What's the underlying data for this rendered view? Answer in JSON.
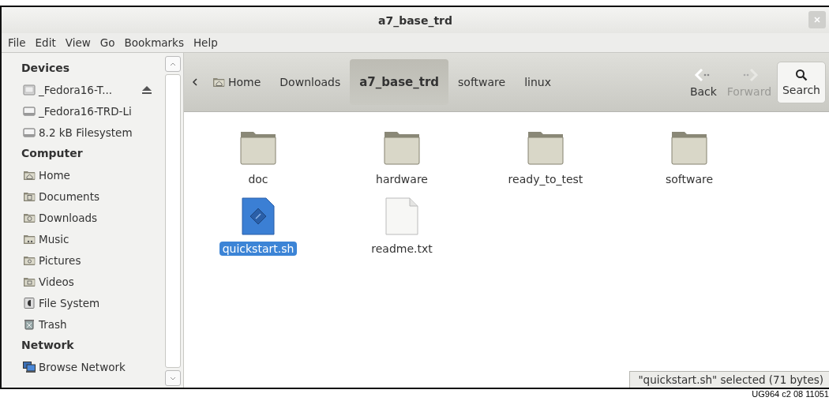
{
  "window": {
    "title": "a7_base_trd"
  },
  "menu": [
    "File",
    "Edit",
    "View",
    "Go",
    "Bookmarks",
    "Help"
  ],
  "sidebar": {
    "sections": [
      {
        "title": "Devices",
        "items": [
          {
            "label": "_Fedora16-T...",
            "kind": "drive",
            "ejectable": true
          },
          {
            "label": "_Fedora16-TRD-Li",
            "kind": "disk",
            "ejectable": false
          },
          {
            "label": "8.2 kB Filesystem",
            "kind": "disk",
            "ejectable": false
          }
        ]
      },
      {
        "title": "Computer",
        "items": [
          {
            "label": "Home",
            "kind": "home",
            "ejectable": false
          },
          {
            "label": "Documents",
            "kind": "documents",
            "ejectable": false
          },
          {
            "label": "Downloads",
            "kind": "downloads",
            "ejectable": false
          },
          {
            "label": "Music",
            "kind": "music",
            "ejectable": false
          },
          {
            "label": "Pictures",
            "kind": "pictures",
            "ejectable": false
          },
          {
            "label": "Videos",
            "kind": "videos",
            "ejectable": false
          },
          {
            "label": "File System",
            "kind": "filesystem",
            "ejectable": false
          },
          {
            "label": "Trash",
            "kind": "trash",
            "ejectable": false
          }
        ]
      },
      {
        "title": "Network",
        "items": [
          {
            "label": "Browse Network",
            "kind": "network",
            "ejectable": false
          }
        ]
      }
    ]
  },
  "path_bar": [
    {
      "label": "Home",
      "kind": "home",
      "selected": false
    },
    {
      "label": "Downloads",
      "kind": "folder",
      "selected": false
    },
    {
      "label": "a7_base_trd",
      "kind": "folder",
      "selected": true
    },
    {
      "label": "software",
      "kind": "folder",
      "selected": false
    },
    {
      "label": "linux",
      "kind": "folder",
      "selected": false
    }
  ],
  "nav": [
    {
      "label": "Back",
      "kind": "back",
      "disabled": false
    },
    {
      "label": "Forward",
      "kind": "forward",
      "disabled": true
    }
  ],
  "search": {
    "label": "Search"
  },
  "files": [
    {
      "name": "doc",
      "kind": "folder",
      "selected": false
    },
    {
      "name": "hardware",
      "kind": "folder",
      "selected": false
    },
    {
      "name": "ready_to_test",
      "kind": "folder",
      "selected": false
    },
    {
      "name": "software",
      "kind": "folder",
      "selected": false
    },
    {
      "name": "quickstart.sh",
      "kind": "script",
      "selected": true
    },
    {
      "name": "readme.txt",
      "kind": "text",
      "selected": false
    }
  ],
  "status_bar": "\"quickstart.sh\" selected (71 bytes)",
  "caption": "UG964 c2 08 11051"
}
